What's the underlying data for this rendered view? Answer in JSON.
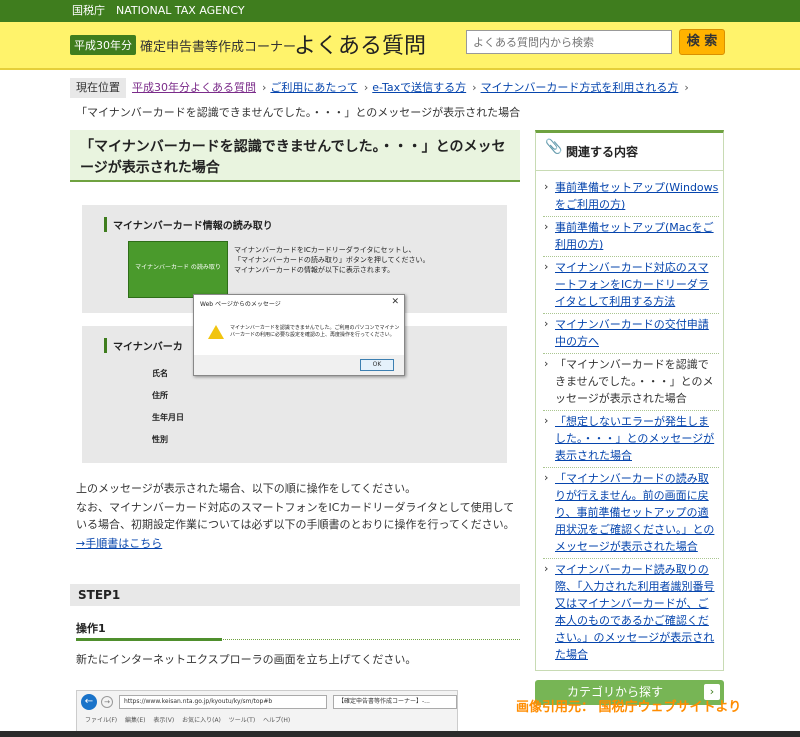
{
  "topbar": {
    "agency": "国税庁　NATIONAL TAX AGENCY"
  },
  "header": {
    "year_badge": "平成30年分",
    "corner_title": "確定申告書等作成コーナー",
    "faq_title": "よくある質問",
    "search_placeholder": "よくある質問内から検索",
    "search_button": "検 索"
  },
  "breadcrumb": {
    "here_label": "現在位置",
    "items": [
      "平成30年分よくある質問",
      "ご利用にあたって",
      "e-Taxで送信する方",
      "マイナンバーカード方式を利用される方"
    ],
    "current": "「マイナンバーカードを認識できませんでした。・・・」とのメッセージが表示された場合"
  },
  "main": {
    "title": "「マイナンバーカードを認識できませんでした。・・・」とのメッセージが表示された場合",
    "screenshot": {
      "panel1_heading": "マイナンバーカード情報の読み取り",
      "card_button": "マイナンバーカード の読み取り",
      "instruction_line1": "マイナンバーカードをICカードリーダライタにセットし、",
      "instruction_line2": "「マイナンバーカードの読み取り」ボタンを押してください。",
      "instruction_line3": "マイナンバーカードの情報が以下に表示されます。",
      "panel2_heading": "マイナンバーカ",
      "fields": [
        "氏名",
        "住所",
        "生年月日",
        "性別"
      ],
      "dialog_title": "Web ページからのメッセージ",
      "dialog_close": "✕",
      "dialog_message": "マイナンバーカードを認識できませんでした。ご利用のパソコンでマイナンバーカードの利用に必要な設定を確認の上、再度操作を行ってください。",
      "dialog_ok": "OK"
    },
    "para1": "上のメッセージが表示された場合、以下の順に操作をしてください。",
    "para2": "なお、マイナンバーカード対応のスマートフォンをICカードリーダライタとして使用している場合、初期設定作業については必ず以下の手順書のとおりに操作を行ってください。",
    "procedure_link": "→手順書はこちら",
    "step1": "STEP1",
    "operation1": "操作1",
    "operation1_text": "新たにインターネットエクスプローラの画面を立ち上げてください。",
    "browser": {
      "url": "https://www.keisan.nta.go.jp/kyoutu/ky/sm/top#b",
      "tab": "【確定申告書等作成コーナー】-...",
      "menu": "ファイル(F)  編集(E)  表示(V)  お気に入り(A)  ツール(T)  ヘルプ(H)"
    }
  },
  "sidebar": {
    "heading": "関連する内容",
    "items": [
      {
        "text": "事前準備セットアップ(Windowsをご利用の方)",
        "link": true
      },
      {
        "text": "事前準備セットアップ(Macをご利用の方)",
        "link": true
      },
      {
        "text": "マイナンバーカード対応のスマートフォンをICカードリーダライタとして利用する方法",
        "link": true
      },
      {
        "text": "マイナンバーカードの交付申請中の方へ",
        "link": true
      },
      {
        "text": "「マイナンバーカードを認識できませんでした。・・・」とのメッセージが表示された場合",
        "link": false
      },
      {
        "text": "「想定しないエラーが発生しました。・・・」とのメッセージが表示された場合",
        "link": true
      },
      {
        "text": "「マイナンバーカードの読み取りが行えません。前の画面に戻り、事前準備セットアップの適用状況をご確認ください。」とのメッセージが表示された場合",
        "link": true
      },
      {
        "text": "マイナンバーカード読み取りの際、「入力された利用者識別番号又はマイナンバーカードが、ご本人のものであるかご確認ください。」のメッセージが表示された場合",
        "link": true
      }
    ],
    "category_button": "カテゴリから探す"
  },
  "credit": "画像引用元： 国税庁ウェブサイトより"
}
